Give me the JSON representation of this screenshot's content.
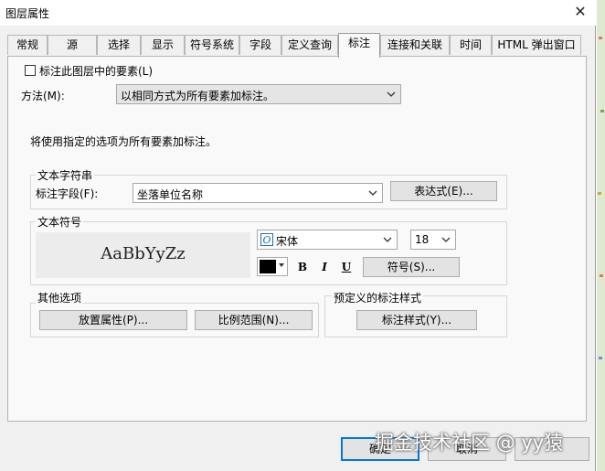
{
  "window": {
    "title": "图层属性",
    "close_glyph": "✕"
  },
  "tabs": [
    {
      "label": "常规"
    },
    {
      "label": "源"
    },
    {
      "label": "选择"
    },
    {
      "label": "显示"
    },
    {
      "label": "符号系统"
    },
    {
      "label": "字段"
    },
    {
      "label": "定义查询"
    },
    {
      "label": "标注"
    },
    {
      "label": "连接和关联"
    },
    {
      "label": "时间"
    },
    {
      "label": "HTML 弹出窗口"
    }
  ],
  "active_tab": "标注",
  "label_layer": {
    "label": "标注此图层中的要素(L)",
    "checked": false
  },
  "method": {
    "label": "方法(M):",
    "value": "以相同方式为所有要素加标注。"
  },
  "info_text": "将使用指定的选项为所有要素加标注。",
  "text_string": {
    "group_title": "文本字符串",
    "field_label": "标注字段(F):",
    "field_value": "坐落单位名称",
    "expression_button": "表达式(E)..."
  },
  "text_symbol": {
    "group_title": "文本符号",
    "preview": "AaBbYyZz",
    "font": "宋体",
    "font_size": "18",
    "color": "#000000",
    "bold": "B",
    "italic": "I",
    "underline": "U",
    "symbol_button": "符号(S)..."
  },
  "other_options": {
    "group_title": "其他选项",
    "placement_button": "放置属性(P)...",
    "scale_button": "比例范围(N)..."
  },
  "predefined": {
    "group_title": "预定义的标注样式",
    "style_button": "标注样式(Y)..."
  },
  "footer": {
    "ok": "确定",
    "cancel": "取消"
  },
  "watermark": "掘金技术社区 @ yy猿"
}
